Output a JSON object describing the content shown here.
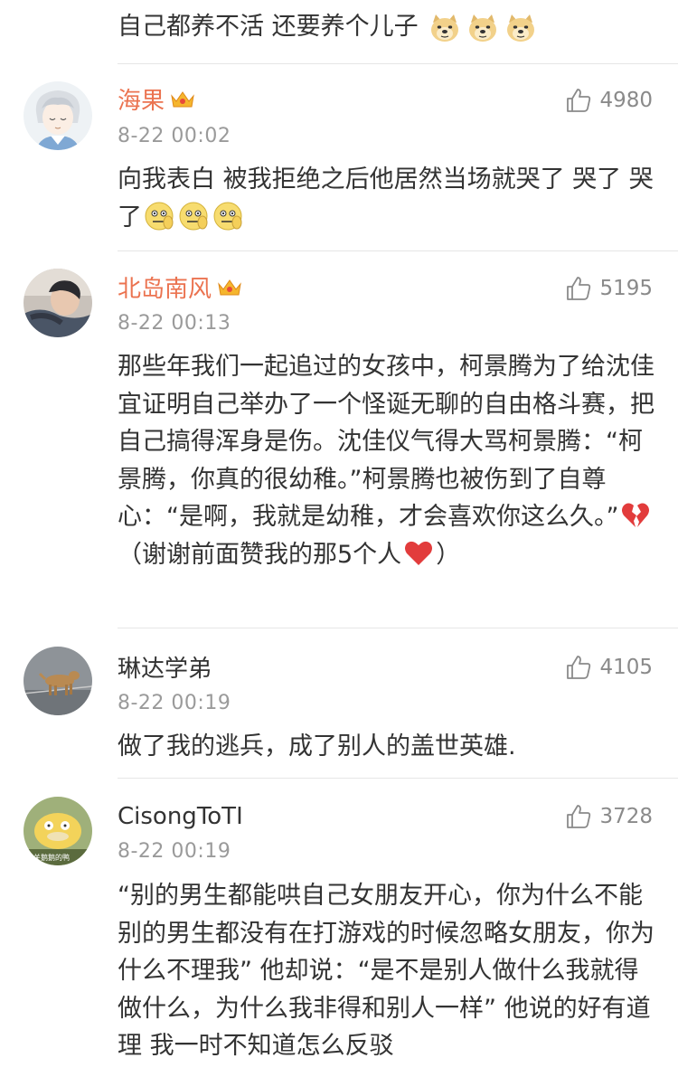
{
  "top_fragment": {
    "text": "自己都养不活 还要养个儿子"
  },
  "comments": [
    {
      "username": "海果",
      "vip": true,
      "time": "8-22 00:02",
      "likes": "4980",
      "body_parts": [
        "向我表白 被我拒绝之后他居然当场就哭了 哭了 哭了"
      ]
    },
    {
      "username": "北岛南风",
      "vip": true,
      "time": "8-22 00:13",
      "likes": "5195",
      "body_parts": [
        "那些年我们一起追过的女孩中，柯景腾为了给沈佳宜证明自己举办了一个怪诞无聊的自由格斗赛，把自己搞得浑身是伤。沈佳仪气得大骂柯景腾：“柯景腾，你真的很幼稚。”柯景腾也被伤到了自尊心：“是啊，我就是幼稚，才会喜欢你这么久。”",
        "（谢谢前面赞我的那5个人",
        "）"
      ]
    },
    {
      "username": "琳达学弟",
      "vip": false,
      "time": "8-22 00:19",
      "likes": "4105",
      "body_parts": [
        "做了我的逃兵，成了别人的盖世英雄."
      ]
    },
    {
      "username": "CisongToTI",
      "vip": false,
      "time": "8-22 00:19",
      "likes": "3728",
      "body_parts": [
        "“别的男生都能哄自己女朋友开心，你为什么不能 别的男生都没有在打游戏的时候忽略女朋友，你为什么不理我” 他却说：“是不是别人做什么我就得做什么，为什么我非得和别人一样” 他说的好有道理 我一时不知道怎么反驳"
      ]
    }
  ],
  "avatar_caption_4": "天关鹅鹅的鸭",
  "icons": {
    "like": "thumbs-up-icon",
    "crown": "vip-crown-icon",
    "doge": "doge-emoji-icon",
    "awkward": "awkward-emoji-icon",
    "broken_heart": "broken-heart-icon",
    "heart": "red-heart-icon"
  },
  "colors": {
    "vip_name": "#eb7350",
    "text": "#333333",
    "meta": "#9a9a9a",
    "divider": "#e6e6e6"
  }
}
